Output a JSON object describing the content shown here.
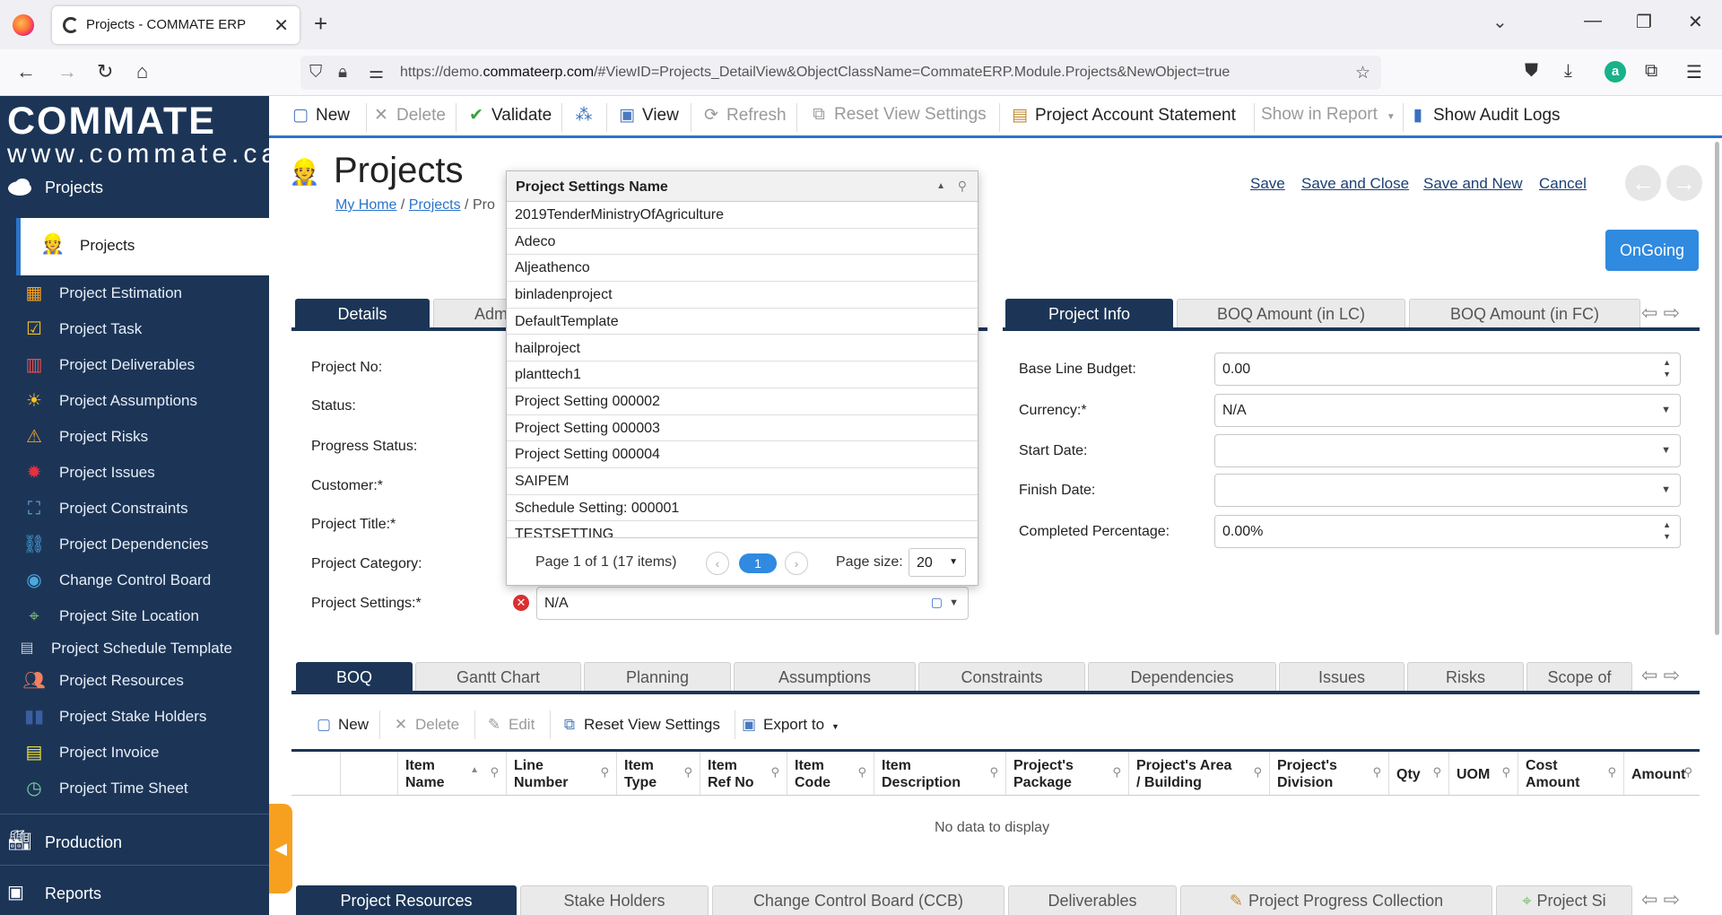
{
  "browser": {
    "tab_title": "Projects - COMMATE ERP",
    "url_prefix": "https://demo.",
    "url_domain": "commateerp.com",
    "url_rest": "/#ViewID=Projects_DetailView&ObjectClassName=CommateERP.Module.Projects&NewObject=true"
  },
  "sidebar": {
    "logo_main": "COMMATE",
    "logo_sub": "www.commate.ca",
    "section_projects": "Projects",
    "active_item": "Projects",
    "items": [
      {
        "label": "Project Estimation",
        "icon": "calculator-icon"
      },
      {
        "label": "Project Task",
        "icon": "checklist-icon"
      },
      {
        "label": "Project Deliverables",
        "icon": "deliverables-icon"
      },
      {
        "label": "Project Assumptions",
        "icon": "sun-icon"
      },
      {
        "label": "Project Risks",
        "icon": "warning-icon"
      },
      {
        "label": "Project Issues",
        "icon": "bug-icon"
      },
      {
        "label": "Project Constraints",
        "icon": "constraints-icon"
      },
      {
        "label": "Project Dependencies",
        "icon": "link-icon"
      },
      {
        "label": "Change Control Board",
        "icon": "board-icon"
      },
      {
        "label": "Project Site Location",
        "icon": "map-icon"
      },
      {
        "label": "Project Schedule Template",
        "icon": "template-icon"
      },
      {
        "label": "Project Resources",
        "icon": "people-icon"
      },
      {
        "label": "Project Stake Holders",
        "icon": "stakeholders-icon"
      },
      {
        "label": "Project Invoice",
        "icon": "invoice-icon"
      },
      {
        "label": "Project Time Sheet",
        "icon": "timesheet-icon"
      }
    ],
    "section_production": "Production",
    "section_reports": "Reports"
  },
  "toolbar": {
    "new": "New",
    "delete": "Delete",
    "validate": "Validate",
    "view": "View",
    "refresh": "Refresh",
    "reset_view": "Reset View Settings",
    "account_statement": "Project Account Statement",
    "show_in_report": "Show in Report",
    "audit_logs": "Show Audit Logs"
  },
  "header": {
    "title": "Projects",
    "crumb_home": "My Home",
    "crumb_projects": "Projects",
    "crumb_rest": "/ Pro",
    "save": "Save",
    "save_close": "Save and Close",
    "save_new": "Save and New",
    "cancel": "Cancel",
    "status_button": "OnGoing"
  },
  "left_tabs": [
    "Details",
    "Adm"
  ],
  "right_tabs": [
    "Project Info",
    "BOQ Amount (in LC)",
    "BOQ Amount (in FC)"
  ],
  "form_left": {
    "project_no": "Project No:",
    "status": "Status:",
    "progress_status": "Progress Status:",
    "customer": "Customer:*",
    "project_title": "Project Title:*",
    "project_category": "Project Category:",
    "project_settings": "Project Settings:*",
    "project_settings_value": "N/A"
  },
  "form_right": {
    "base_line_budget": "Base Line Budget:",
    "base_line_budget_value": "0.00",
    "currency": "Currency:*",
    "currency_value": "N/A",
    "start_date": "Start Date:",
    "start_date_value": "",
    "finish_date": "Finish Date:",
    "finish_date_value": "",
    "completed_percentage": "Completed Percentage:",
    "completed_percentage_value": "0.00%"
  },
  "popup": {
    "column": "Project Settings Name",
    "rows": [
      "2019TenderMinistryOfAgriculture",
      "Adeco",
      "Aljeathenco",
      "binladenproject",
      "DefaultTemplate",
      "hailproject",
      "planttech1",
      "Project Setting 000002",
      "Project Setting 000003",
      "Project Setting 000004",
      "SAIPEM",
      "Schedule Setting: 000001",
      "TESTSETTING"
    ],
    "page_info": "Page 1 of 1 (17 items)",
    "current_page": "1",
    "page_size_label": "Page size:",
    "page_size": "20"
  },
  "bottom_tabs": [
    "BOQ",
    "Gantt Chart",
    "Planning",
    "Assumptions",
    "Constraints",
    "Dependencies",
    "Issues",
    "Risks",
    "Scope of"
  ],
  "grid_toolbar": {
    "new": "New",
    "delete": "Delete",
    "edit": "Edit",
    "reset_view": "Reset View Settings",
    "export": "Export to"
  },
  "grid_columns": [
    {
      "l1": "Item",
      "l2": "Name"
    },
    {
      "l1": "Line",
      "l2": "Number"
    },
    {
      "l1": "Item",
      "l2": "Type"
    },
    {
      "l1": "Item",
      "l2": "Ref No"
    },
    {
      "l1": "Item",
      "l2": "Code"
    },
    {
      "l1": "Item",
      "l2": "Description"
    },
    {
      "l1": "Project's",
      "l2": "Package"
    },
    {
      "l1": "Project's Area",
      "l2": "/ Building"
    },
    {
      "l1": "Project's",
      "l2": "Division"
    },
    {
      "l1": "Qty",
      "l2": ""
    },
    {
      "l1": "UOM",
      "l2": ""
    },
    {
      "l1": "Cost",
      "l2": "Amount"
    },
    {
      "l1": "Amount",
      "l2": ""
    }
  ],
  "grid_empty": "No data to display",
  "footer_tabs": [
    "Project Resources",
    "Stake Holders",
    "Change Control Board (CCB)",
    "Deliverables",
    "Project Progress Collection",
    "Project Si"
  ]
}
